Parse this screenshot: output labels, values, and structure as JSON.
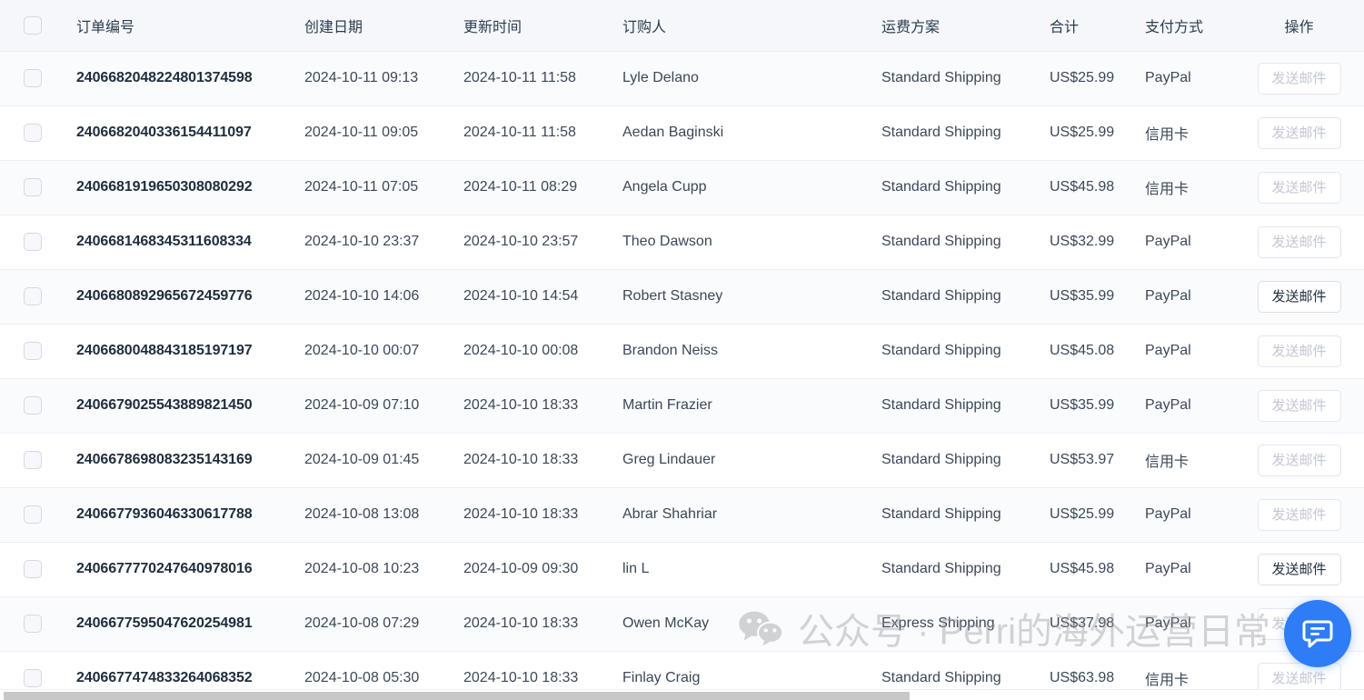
{
  "table": {
    "columns": [
      {
        "key": "select",
        "label": ""
      },
      {
        "key": "order",
        "label": "订单编号"
      },
      {
        "key": "created",
        "label": "创建日期"
      },
      {
        "key": "updated",
        "label": "更新时间"
      },
      {
        "key": "buyer",
        "label": "订购人"
      },
      {
        "key": "ship",
        "label": "运费方案"
      },
      {
        "key": "total",
        "label": "合计"
      },
      {
        "key": "pay",
        "label": "支付方式"
      },
      {
        "key": "action",
        "label": "操作"
      }
    ],
    "action_button_label": "发送邮件",
    "rows": [
      {
        "order": "2406682048224801374598",
        "created": "2024-10-11 09:13",
        "updated": "2024-10-11 11:58",
        "buyer": "Lyle Delano",
        "ship": "Standard Shipping",
        "total": "US$25.99",
        "pay": "PayPal",
        "action_enabled": false
      },
      {
        "order": "2406682040336154411097",
        "created": "2024-10-11 09:05",
        "updated": "2024-10-11 11:58",
        "buyer": "Aedan Baginski",
        "ship": "Standard Shipping",
        "total": "US$25.99",
        "pay": "信用卡",
        "action_enabled": false
      },
      {
        "order": "2406681919650308080292",
        "created": "2024-10-11 07:05",
        "updated": "2024-10-11 08:29",
        "buyer": "Angela Cupp",
        "ship": "Standard Shipping",
        "total": "US$45.98",
        "pay": "信用卡",
        "action_enabled": false
      },
      {
        "order": "2406681468345311608334",
        "created": "2024-10-10 23:37",
        "updated": "2024-10-10 23:57",
        "buyer": "Theo Dawson",
        "ship": "Standard Shipping",
        "total": "US$32.99",
        "pay": "PayPal",
        "action_enabled": false
      },
      {
        "order": "2406680892965672459776",
        "created": "2024-10-10 14:06",
        "updated": "2024-10-10 14:54",
        "buyer": "Robert Stasney",
        "ship": "Standard Shipping",
        "total": "US$35.99",
        "pay": "PayPal",
        "action_enabled": true
      },
      {
        "order": "2406680048843185197197",
        "created": "2024-10-10 00:07",
        "updated": "2024-10-10 00:08",
        "buyer": "Brandon Neiss",
        "ship": "Standard Shipping",
        "total": "US$45.08",
        "pay": "PayPal",
        "action_enabled": false
      },
      {
        "order": "2406679025543889821450",
        "created": "2024-10-09 07:10",
        "updated": "2024-10-10 18:33",
        "buyer": "Martin Frazier",
        "ship": "Standard Shipping",
        "total": "US$35.99",
        "pay": "PayPal",
        "action_enabled": false
      },
      {
        "order": "2406678698083235143169",
        "created": "2024-10-09 01:45",
        "updated": "2024-10-10 18:33",
        "buyer": "Greg Lindauer",
        "ship": "Standard Shipping",
        "total": "US$53.97",
        "pay": "信用卡",
        "action_enabled": false
      },
      {
        "order": "2406677936046330617788",
        "created": "2024-10-08 13:08",
        "updated": "2024-10-10 18:33",
        "buyer": "Abrar Shahriar",
        "ship": "Standard Shipping",
        "total": "US$25.99",
        "pay": "PayPal",
        "action_enabled": false
      },
      {
        "order": "2406677770247640978016",
        "created": "2024-10-08 10:23",
        "updated": "2024-10-09 09:30",
        "buyer": "lin L",
        "ship": "Standard Shipping",
        "total": "US$45.98",
        "pay": "PayPal",
        "action_enabled": true
      },
      {
        "order": "2406677595047620254981",
        "created": "2024-10-08 07:29",
        "updated": "2024-10-10 18:33",
        "buyer": "Owen McKay",
        "ship": "Express Shipping",
        "total": "US$37.98",
        "pay": "PayPal",
        "action_enabled": false
      },
      {
        "order": "2406677474833264068352",
        "created": "2024-10-08 05:30",
        "updated": "2024-10-10 18:33",
        "buyer": "Finlay Craig",
        "ship": "Standard Shipping",
        "total": "US$63.98",
        "pay": "信用卡",
        "action_enabled": false
      }
    ]
  },
  "watermark": {
    "text": "公众号 · Perri的海外运营日常",
    "icon": "wechat-icon"
  },
  "floating_chat": {
    "icon": "chat-bubble-icon",
    "color": "#2e7cf6"
  },
  "colors": {
    "header_bg": "#f5f7fa",
    "row_alt_bg": "#fafbfd",
    "border": "#ebeef5",
    "text": "#3c4858",
    "accent": "#2e7cf6"
  }
}
